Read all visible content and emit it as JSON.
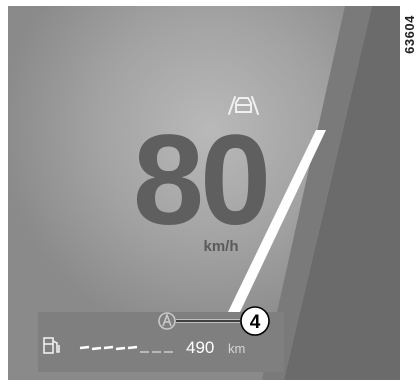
{
  "figure_ref": "63604",
  "speed": {
    "value": "80",
    "unit": "km/h"
  },
  "range": {
    "value": "490",
    "unit": "km"
  },
  "callout": {
    "number": "4"
  },
  "fuel_gauge": {
    "level": 0.6
  },
  "icons": {
    "lane_assist": "lane-keeping-car-icon",
    "autonomy_indicator": "circled-A-icon",
    "fuel": "fuel-pump-icon"
  },
  "colors": {
    "background": "#8f8f8f",
    "digits": "#5f5f5f",
    "road_line": "#ffffff",
    "range_text": "#ffffff"
  }
}
